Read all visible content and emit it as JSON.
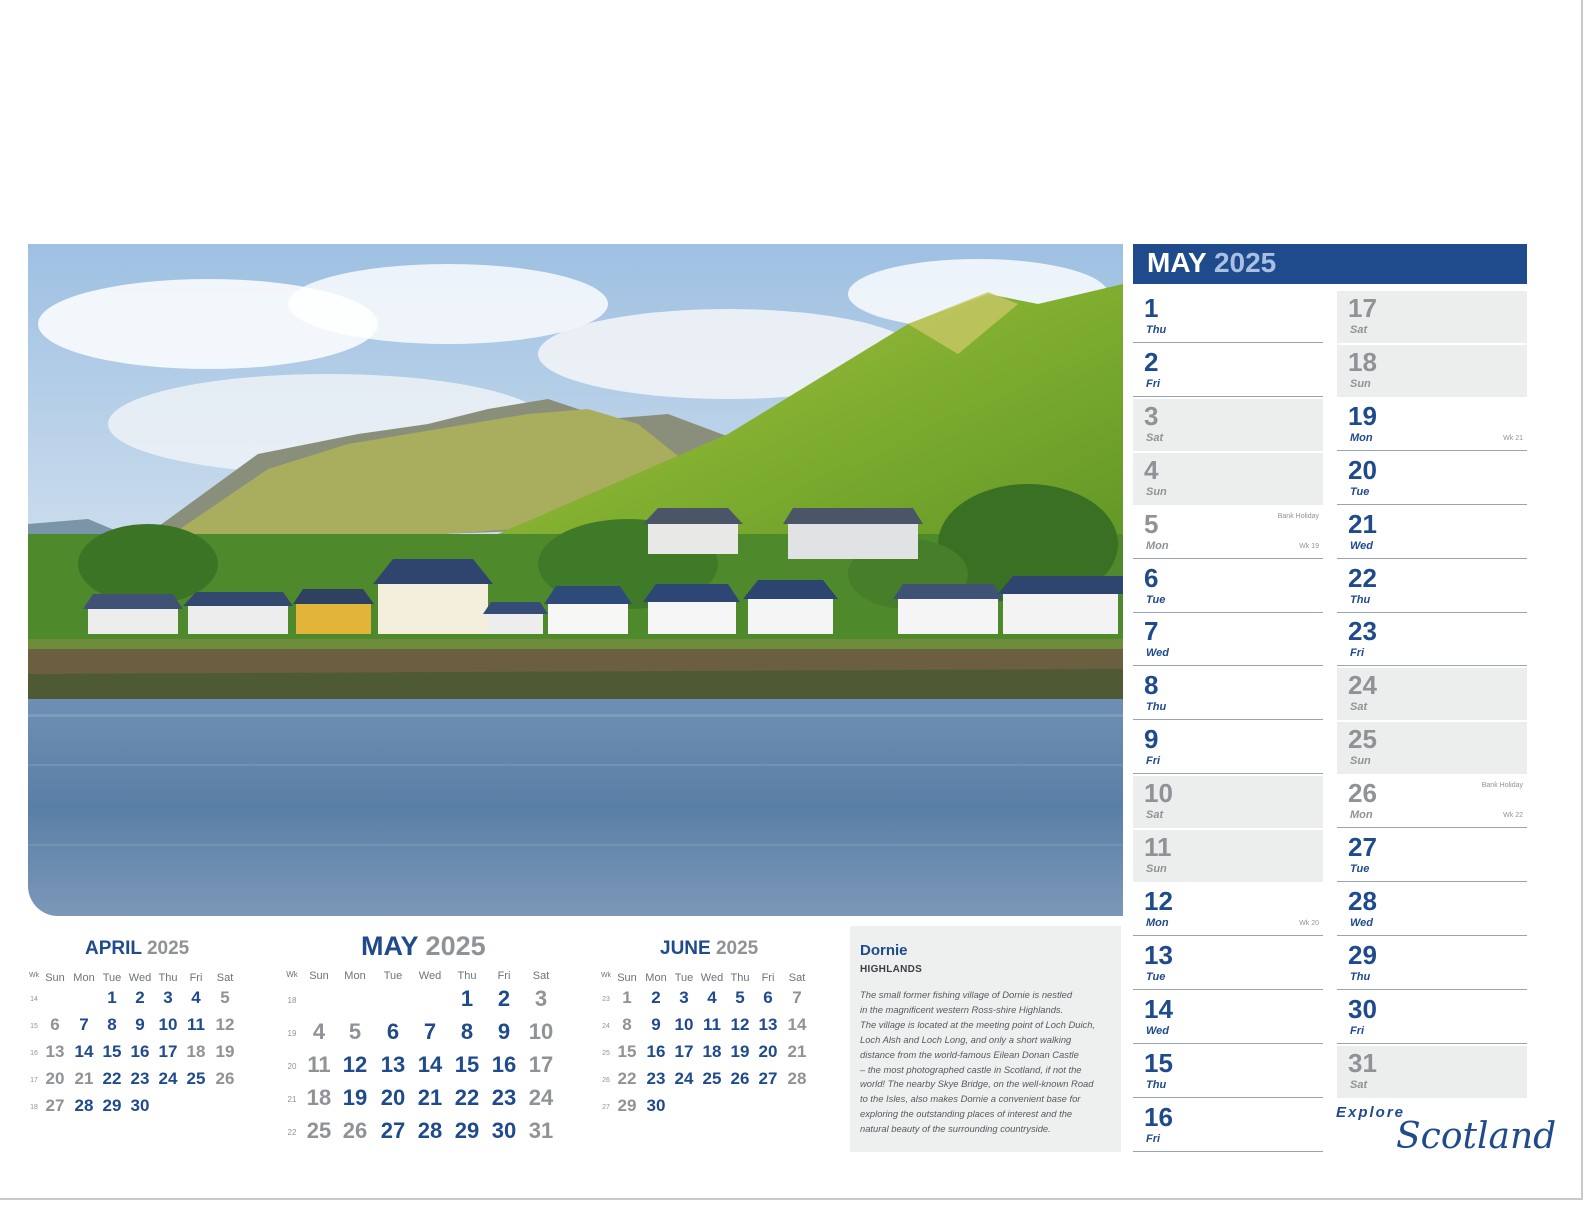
{
  "header": {
    "month": "MAY",
    "year": "2025"
  },
  "days_col1": [
    {
      "num": "1",
      "name": "Thu",
      "weekend": false
    },
    {
      "num": "2",
      "name": "Fri",
      "weekend": false
    },
    {
      "num": "3",
      "name": "Sat",
      "weekend": true
    },
    {
      "num": "4",
      "name": "Sun",
      "weekend": true
    },
    {
      "num": "5",
      "name": "Mon",
      "weekend": false,
      "holiday": true,
      "note": "Bank Holiday",
      "wk": "Wk 19"
    },
    {
      "num": "6",
      "name": "Tue",
      "weekend": false
    },
    {
      "num": "7",
      "name": "Wed",
      "weekend": false
    },
    {
      "num": "8",
      "name": "Thu",
      "weekend": false
    },
    {
      "num": "9",
      "name": "Fri",
      "weekend": false
    },
    {
      "num": "10",
      "name": "Sat",
      "weekend": true
    },
    {
      "num": "11",
      "name": "Sun",
      "weekend": true
    },
    {
      "num": "12",
      "name": "Mon",
      "weekend": false,
      "wk": "Wk 20"
    },
    {
      "num": "13",
      "name": "Tue",
      "weekend": false
    },
    {
      "num": "14",
      "name": "Wed",
      "weekend": false
    },
    {
      "num": "15",
      "name": "Thu",
      "weekend": false
    },
    {
      "num": "16",
      "name": "Fri",
      "weekend": false
    }
  ],
  "days_col2": [
    {
      "num": "17",
      "name": "Sat",
      "weekend": true
    },
    {
      "num": "18",
      "name": "Sun",
      "weekend": true
    },
    {
      "num": "19",
      "name": "Mon",
      "weekend": false,
      "wk": "Wk 21"
    },
    {
      "num": "20",
      "name": "Tue",
      "weekend": false
    },
    {
      "num": "21",
      "name": "Wed",
      "weekend": false
    },
    {
      "num": "22",
      "name": "Thu",
      "weekend": false
    },
    {
      "num": "23",
      "name": "Fri",
      "weekend": false
    },
    {
      "num": "24",
      "name": "Sat",
      "weekend": true
    },
    {
      "num": "25",
      "name": "Sun",
      "weekend": true
    },
    {
      "num": "26",
      "name": "Mon",
      "weekend": false,
      "holiday": true,
      "note": "Bank Holiday",
      "wk": "Wk 22"
    },
    {
      "num": "27",
      "name": "Tue",
      "weekend": false
    },
    {
      "num": "28",
      "name": "Wed",
      "weekend": false
    },
    {
      "num": "29",
      "name": "Thu",
      "weekend": false
    },
    {
      "num": "30",
      "name": "Fri",
      "weekend": false
    },
    {
      "num": "31",
      "name": "Sat",
      "weekend": true
    }
  ],
  "mini_calendars": [
    {
      "month": "APRIL",
      "year": "2025",
      "headers": [
        "Wk",
        "Sun",
        "Mon",
        "Tue",
        "Wed",
        "Thu",
        "Fri",
        "Sat"
      ],
      "weeks": [
        {
          "wk": "14",
          "days": [
            "",
            "",
            "1",
            "2",
            "3",
            "4",
            "5"
          ]
        },
        {
          "wk": "15",
          "days": [
            "6",
            "7",
            "8",
            "9",
            "10",
            "11",
            "12"
          ]
        },
        {
          "wk": "16",
          "days": [
            "13",
            "14",
            "15",
            "16",
            "17",
            "18",
            "19"
          ]
        },
        {
          "wk": "17",
          "days": [
            "20",
            "21",
            "22",
            "23",
            "24",
            "25",
            "26"
          ]
        },
        {
          "wk": "18",
          "days": [
            "27",
            "28",
            "29",
            "30",
            "",
            "",
            ""
          ]
        }
      ],
      "grey": [
        "5",
        "6",
        "12",
        "13",
        "18",
        "19",
        "20",
        "21",
        "26",
        "27"
      ]
    },
    {
      "month": "MAY",
      "year": "2025",
      "headers": [
        "Wk",
        "Sun",
        "Mon",
        "Tue",
        "Wed",
        "Thu",
        "Fri",
        "Sat"
      ],
      "weeks": [
        {
          "wk": "18",
          "days": [
            "",
            "",
            "",
            "",
            "1",
            "2",
            "3"
          ]
        },
        {
          "wk": "19",
          "days": [
            "4",
            "5",
            "6",
            "7",
            "8",
            "9",
            "10"
          ]
        },
        {
          "wk": "20",
          "days": [
            "11",
            "12",
            "13",
            "14",
            "15",
            "16",
            "17"
          ]
        },
        {
          "wk": "21",
          "days": [
            "18",
            "19",
            "20",
            "21",
            "22",
            "23",
            "24"
          ]
        },
        {
          "wk": "22",
          "days": [
            "25",
            "26",
            "27",
            "28",
            "29",
            "30",
            "31"
          ]
        }
      ],
      "grey": [
        "3",
        "4",
        "5",
        "10",
        "11",
        "17",
        "18",
        "24",
        "25",
        "26",
        "31"
      ]
    },
    {
      "month": "JUNE",
      "year": "2025",
      "headers": [
        "Wk",
        "Sun",
        "Mon",
        "Tue",
        "Wed",
        "Thu",
        "Fri",
        "Sat"
      ],
      "weeks": [
        {
          "wk": "23",
          "days": [
            "1",
            "2",
            "3",
            "4",
            "5",
            "6",
            "7"
          ]
        },
        {
          "wk": "24",
          "days": [
            "8",
            "9",
            "10",
            "11",
            "12",
            "13",
            "14"
          ]
        },
        {
          "wk": "25",
          "days": [
            "15",
            "16",
            "17",
            "18",
            "19",
            "20",
            "21"
          ]
        },
        {
          "wk": "26",
          "days": [
            "22",
            "23",
            "24",
            "25",
            "26",
            "27",
            "28"
          ]
        },
        {
          "wk": "27",
          "days": [
            "29",
            "30",
            "",
            "",
            "",
            "",
            ""
          ]
        }
      ],
      "grey": [
        "1",
        "7",
        "8",
        "14",
        "15",
        "21",
        "22",
        "28",
        "29"
      ]
    }
  ],
  "description": {
    "place": "Dornie",
    "region": "HIGHLANDS",
    "lines": [
      "The small former fishing village of Dornie is nestled",
      "in the magnificent western Ross-shire Highlands.",
      "The village is located at the meeting point of Loch Duich,",
      "Loch Alsh and Loch Long, and only a short walking",
      "distance from the world-famous Eilean Donan Castle",
      "– the most photographed castle in Scotland, if not the",
      "world! The nearby Skye Bridge, on the well-known Road",
      "to the Isles, also makes Dornie a convenient base for",
      "exploring the outstanding places of interest and the",
      "natural beauty of the surrounding countryside."
    ]
  },
  "logo": {
    "explore": "Explore",
    "scotland": "Scotland"
  },
  "colors": {
    "brand": "#1f4a8c",
    "grey_text": "#8f9297",
    "weekend_bg": "#eceeee"
  }
}
